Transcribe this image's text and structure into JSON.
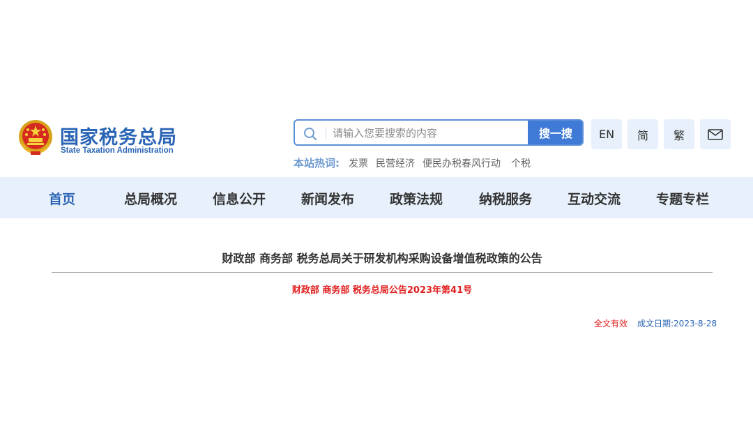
{
  "header": {
    "logo_cn": "国家税务总局",
    "logo_en": "State Taxation Administration",
    "search": {
      "placeholder": "请输入您要搜索的内容",
      "button_label": "搜一搜"
    },
    "tools": {
      "en_label": "EN",
      "simplified_label": "简",
      "traditional_label": "繁",
      "mail_icon": "mail-icon"
    },
    "hot": {
      "label": "本站热词:",
      "items": [
        "发票",
        "民营经济",
        "便民办税春风行动",
        "个税"
      ]
    }
  },
  "nav": {
    "items": [
      {
        "label": "首页"
      },
      {
        "label": "总局概况"
      },
      {
        "label": "信息公开"
      },
      {
        "label": "新闻发布"
      },
      {
        "label": "政策法规"
      },
      {
        "label": "纳税服务"
      },
      {
        "label": "互动交流"
      },
      {
        "label": "专题专栏"
      }
    ]
  },
  "document": {
    "title": "财政部 商务部 税务总局关于研发机构采购设备增值税政策的公告",
    "number": "财政部 商务部 税务总局公告2023年第41号",
    "status": "全文有效",
    "date": "成文日期:2023-8-28"
  },
  "colors": {
    "brand": "#2a64b4",
    "search_button": "#3f7ad6",
    "nav_bg": "#e7f0fb",
    "alert": "#e02020"
  }
}
